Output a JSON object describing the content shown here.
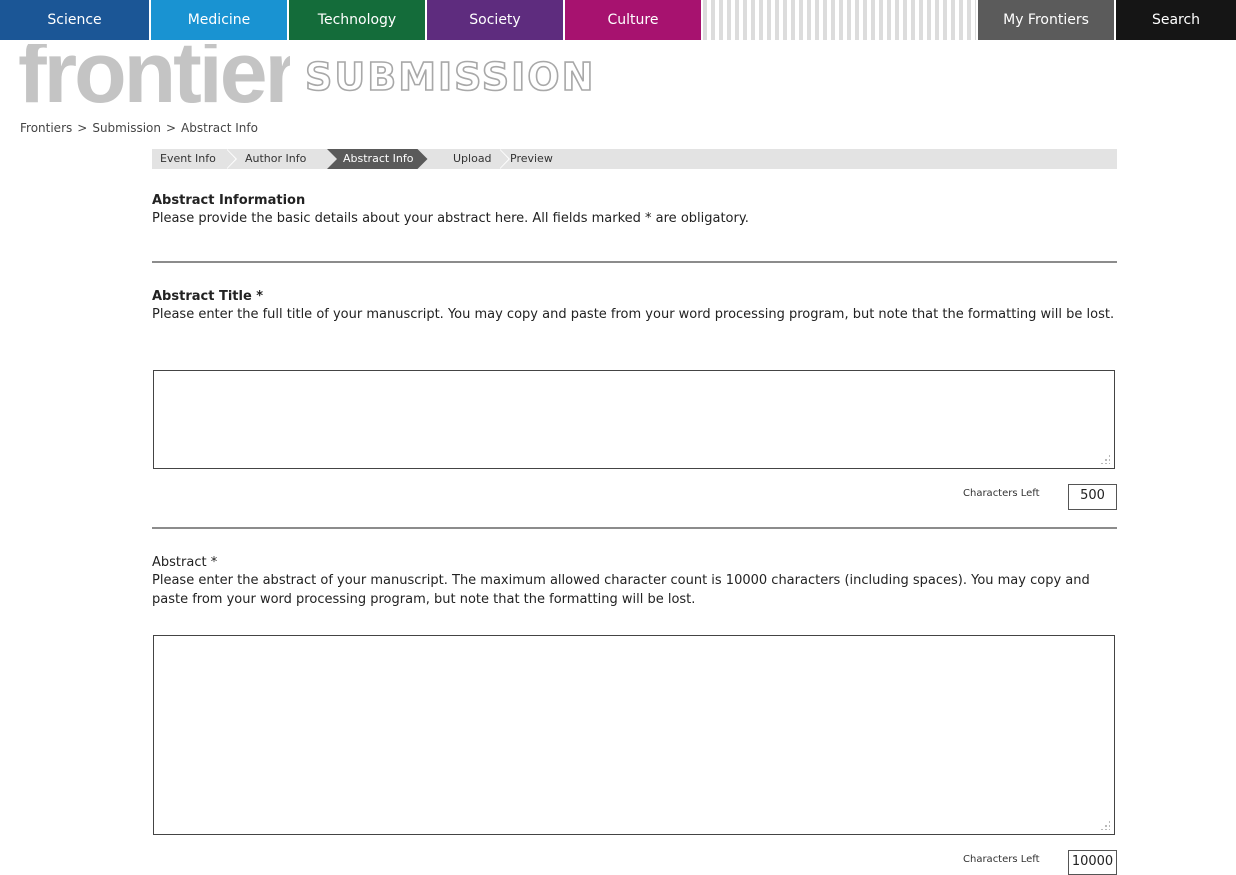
{
  "nav": {
    "items": [
      {
        "label": "Science",
        "color": "#1b5696"
      },
      {
        "label": "Medicine",
        "color": "#1993d2"
      },
      {
        "label": "Technology",
        "color": "#146c3a"
      },
      {
        "label": "Society",
        "color": "#5e2c7e"
      },
      {
        "label": "Culture",
        "color": "#a7126f"
      }
    ],
    "my_frontiers": {
      "label": "My Frontiers",
      "color": "#5b5b5b"
    },
    "search": {
      "label": "Search",
      "color": "#151515"
    }
  },
  "logo": {
    "word": "frontiers",
    "sub": "SUBMISSION"
  },
  "breadcrumb": [
    "Frontiers",
    "Submission",
    "Abstract Info"
  ],
  "steps": [
    {
      "label": "Event Info",
      "active": false
    },
    {
      "label": "Author Info",
      "active": false
    },
    {
      "label": "Abstract Info",
      "active": true
    },
    {
      "label": "Upload",
      "active": false
    },
    {
      "label": "Preview",
      "active": false
    }
  ],
  "intro": {
    "title": "Abstract Information",
    "desc": "Please provide the basic details about your abstract here. All fields marked * are obligatory."
  },
  "title_field": {
    "label": "Abstract Title *",
    "desc": "Please enter the full title of your manuscript. You may copy and paste from your word processing program, but note that the formatting will be lost.",
    "value": "",
    "chars_left_label": "Characters Left",
    "chars_left": "500"
  },
  "abstract_field": {
    "label": "Abstract *",
    "desc": "Please enter the abstract of your manuscript. The maximum allowed character count is 10000 characters (including spaces). You may copy and paste from your word processing program, but note that the formatting will be lost.",
    "value": "",
    "chars_left_label": "Characters Left",
    "chars_left": "10000"
  }
}
